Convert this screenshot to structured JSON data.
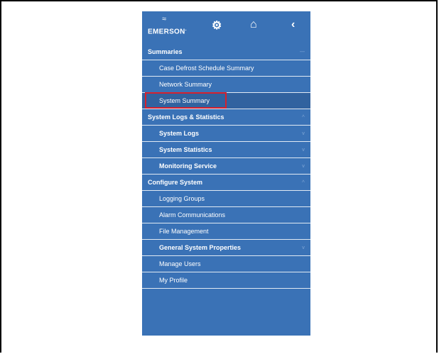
{
  "sidebar": {
    "brand": "EMERSON",
    "toolbar": {
      "settings_icon": "gear-icon",
      "home_icon": "home-icon",
      "collapse_icon": "chevron-left-icon"
    },
    "summaries_header": "Summaries",
    "summaries_items": [
      "Case Defrost Schedule Summary",
      "Network Summary",
      "System Summary"
    ],
    "logs_header": "System Logs & Statistics",
    "logs_items": [
      "System Logs",
      "System Statistics",
      "Monitoring Service"
    ],
    "configure_header": "Configure System",
    "configure_items": [
      "Logging Groups",
      "Alarm Communications",
      "File Management",
      "General System Properties",
      "Manage Users",
      "My Profile"
    ]
  },
  "highlight_color": "#d6212d",
  "accent_color": "#3a72b6"
}
